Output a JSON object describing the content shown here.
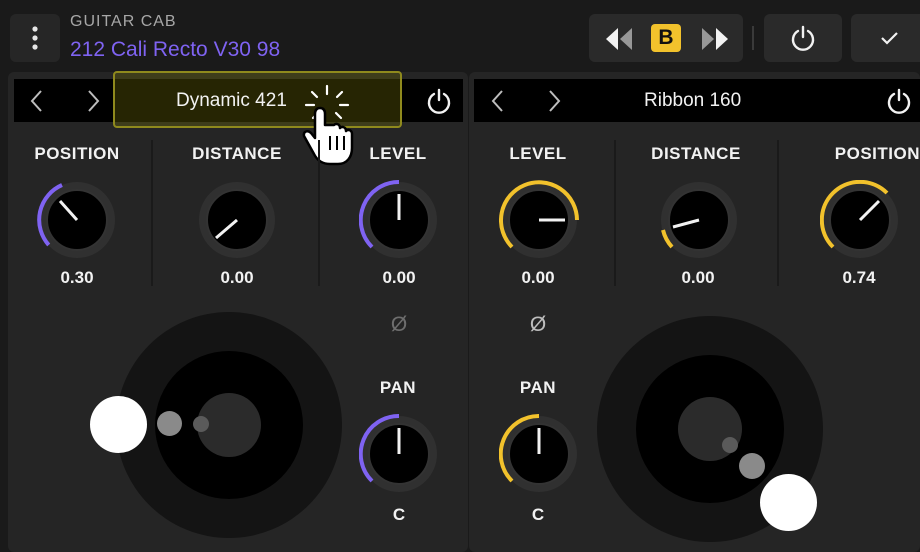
{
  "header": {
    "category": "GUITAR CAB",
    "preset": "212 Cali Recto V30 98",
    "ab_selected": "B",
    "icons": [
      "kebab-menu-icon",
      "rewind-icon",
      "fast-forward-icon",
      "power-icon",
      "check-icon"
    ]
  },
  "colors": {
    "purple": "#7f63f2",
    "yellow": "#f2c22c",
    "panel": "#252525"
  },
  "mic1": {
    "name": "Dynamic 421",
    "position": {
      "label": "POSITION",
      "value": "0.30"
    },
    "distance": {
      "label": "DISTANCE",
      "value": "0.00"
    },
    "level": {
      "label": "LEVEL",
      "value": "0.00"
    },
    "pan": {
      "label": "PAN",
      "value": "C"
    },
    "phase_symbol": "Ø"
  },
  "mic2": {
    "name": "Ribbon 160",
    "level": {
      "label": "LEVEL",
      "value": "0.00"
    },
    "distance": {
      "label": "DISTANCE",
      "value": "0.00"
    },
    "position": {
      "label": "POSITION",
      "value": "0.74"
    },
    "pan": {
      "label": "PAN",
      "value": "C"
    },
    "phase_symbol": "Ø"
  }
}
